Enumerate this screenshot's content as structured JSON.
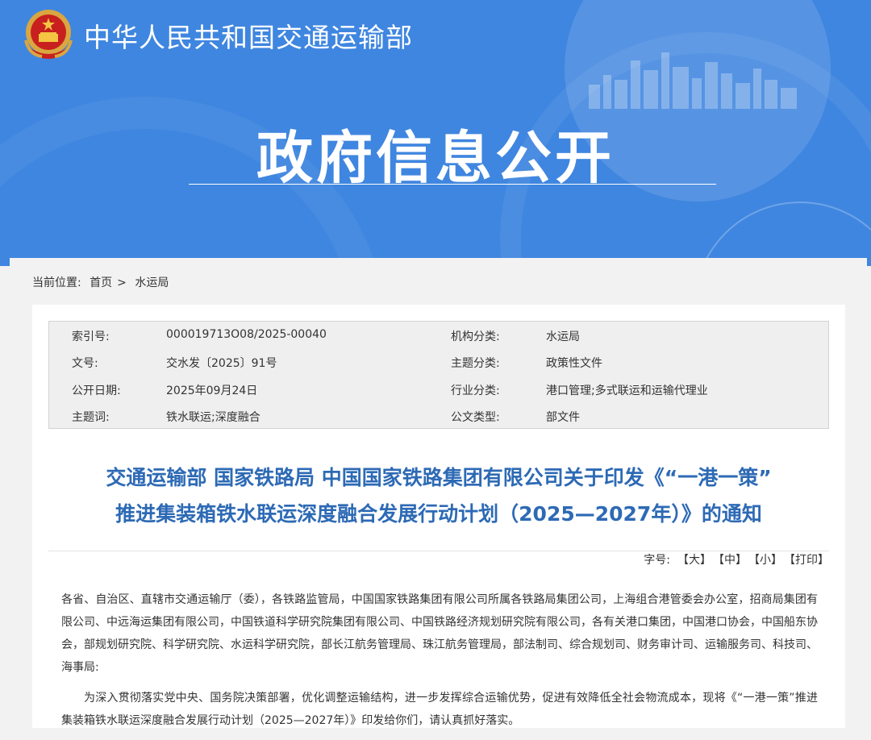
{
  "header": {
    "site_name": "中华人民共和国交通运输部",
    "big_title": "政府信息公开"
  },
  "breadcrumb": {
    "label": "当前位置:",
    "home": "首页",
    "sep": ">",
    "current": "水运局"
  },
  "meta": {
    "index_label": "索引号:",
    "index_value": "000019713O08/2025-00040",
    "org_label": "机构分类:",
    "org_value": "水运局",
    "doc_no_label": "文号:",
    "doc_no_value": "交水发〔2025〕91号",
    "topic_label": "主题分类:",
    "topic_value": "政策性文件",
    "date_label": "公开日期:",
    "date_value": "2025年09月24日",
    "industry_label": "行业分类:",
    "industry_value": "港口管理;多式联运和运输代理业",
    "keywords_label": "主题词:",
    "keywords_value": "铁水联运;深度融合",
    "doctype_label": "公文类型:",
    "doctype_value": "部文件"
  },
  "document": {
    "title_line1": "交通运输部 国家铁路局 中国国家铁路集团有限公司关于印发《“一港一策”",
    "title_line2": "推进集装箱铁水联运深度融合发展行动计划（2025—2027年）》的通知",
    "font_size_label": "字号:",
    "font_large": "【大】",
    "font_medium": "【中】",
    "font_small": "【小】",
    "print": "【打印】",
    "paragraph1": "各省、自治区、直辖市交通运输厅（委），各铁路监管局，中国国家铁路集团有限公司所属各铁路局集团公司，上海组合港管委会办公室，招商局集团有限公司、中远海运集团有限公司，中国铁道科学研究院集团有限公司、中国铁路经济规划研究院有限公司，各有关港口集团，中国港口协会，中国船东协会，部规划研究院、科学研究院、水运科学研究院，部长江航务管理局、珠江航务管理局，部法制司、综合规划司、财务审计司、运输服务司、科技司、海事局:",
    "paragraph2": "为深入贯彻落实党中央、国务院决策部署，优化调整运输结构，进一步发挥综合运输优势，促进有效降低全社会物流成本，现将《“一港一策”推进集装箱铁水联运深度融合发展行动计划（2025—2027年）》印发给你们，请认真抓好落实。"
  }
}
